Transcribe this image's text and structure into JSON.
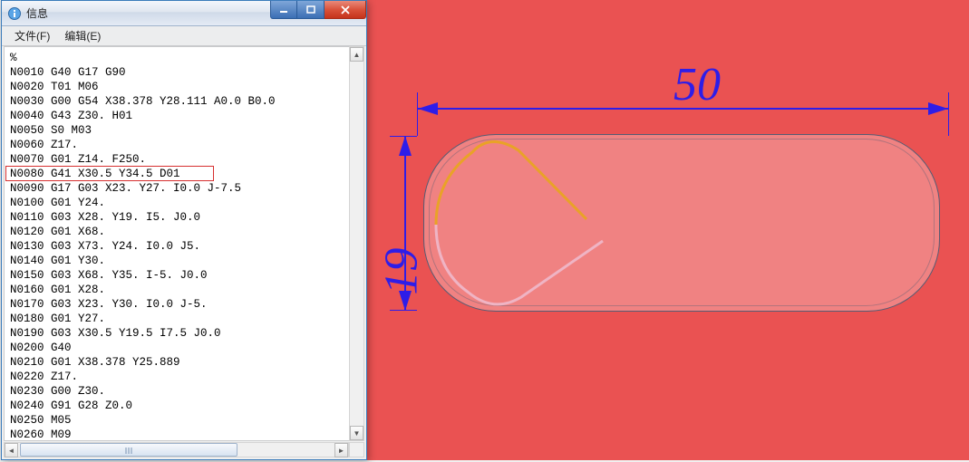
{
  "cad": {
    "dim_top": "50",
    "dim_left": "19"
  },
  "window": {
    "title": "信息",
    "menu": {
      "file": "文件(F)",
      "edit": "编辑(E)"
    },
    "code_lines": [
      "%",
      "N0010 G40 G17 G90",
      "N0020 T01 M06",
      "N0030 G00 G54 X38.378 Y28.111 A0.0 B0.0",
      "N0040 G43 Z30. H01",
      "N0050 S0 M03",
      "N0060 Z17.",
      "N0070 G01 Z14. F250.",
      "N0080 G41 X30.5 Y34.5 D01",
      "N0090 G17 G03 X23. Y27. I0.0 J-7.5",
      "N0100 G01 Y24.",
      "N0110 G03 X28. Y19. I5. J0.0",
      "N0120 G01 X68.",
      "N0130 G03 X73. Y24. I0.0 J5.",
      "N0140 G01 Y30.",
      "N0150 G03 X68. Y35. I-5. J0.0",
      "N0160 G01 X28.",
      "N0170 G03 X23. Y30. I0.0 J-5.",
      "N0180 G01 Y27.",
      "N0190 G03 X30.5 Y19.5 I7.5 J0.0",
      "N0200 G40",
      "N0210 G01 X38.378 Y25.889",
      "N0220 Z17.",
      "N0230 G00 Z30.",
      "N0240 G91 G28 Z0.0",
      "N0250 M05",
      "N0260 M09"
    ],
    "highlighted_line_index": 8
  }
}
